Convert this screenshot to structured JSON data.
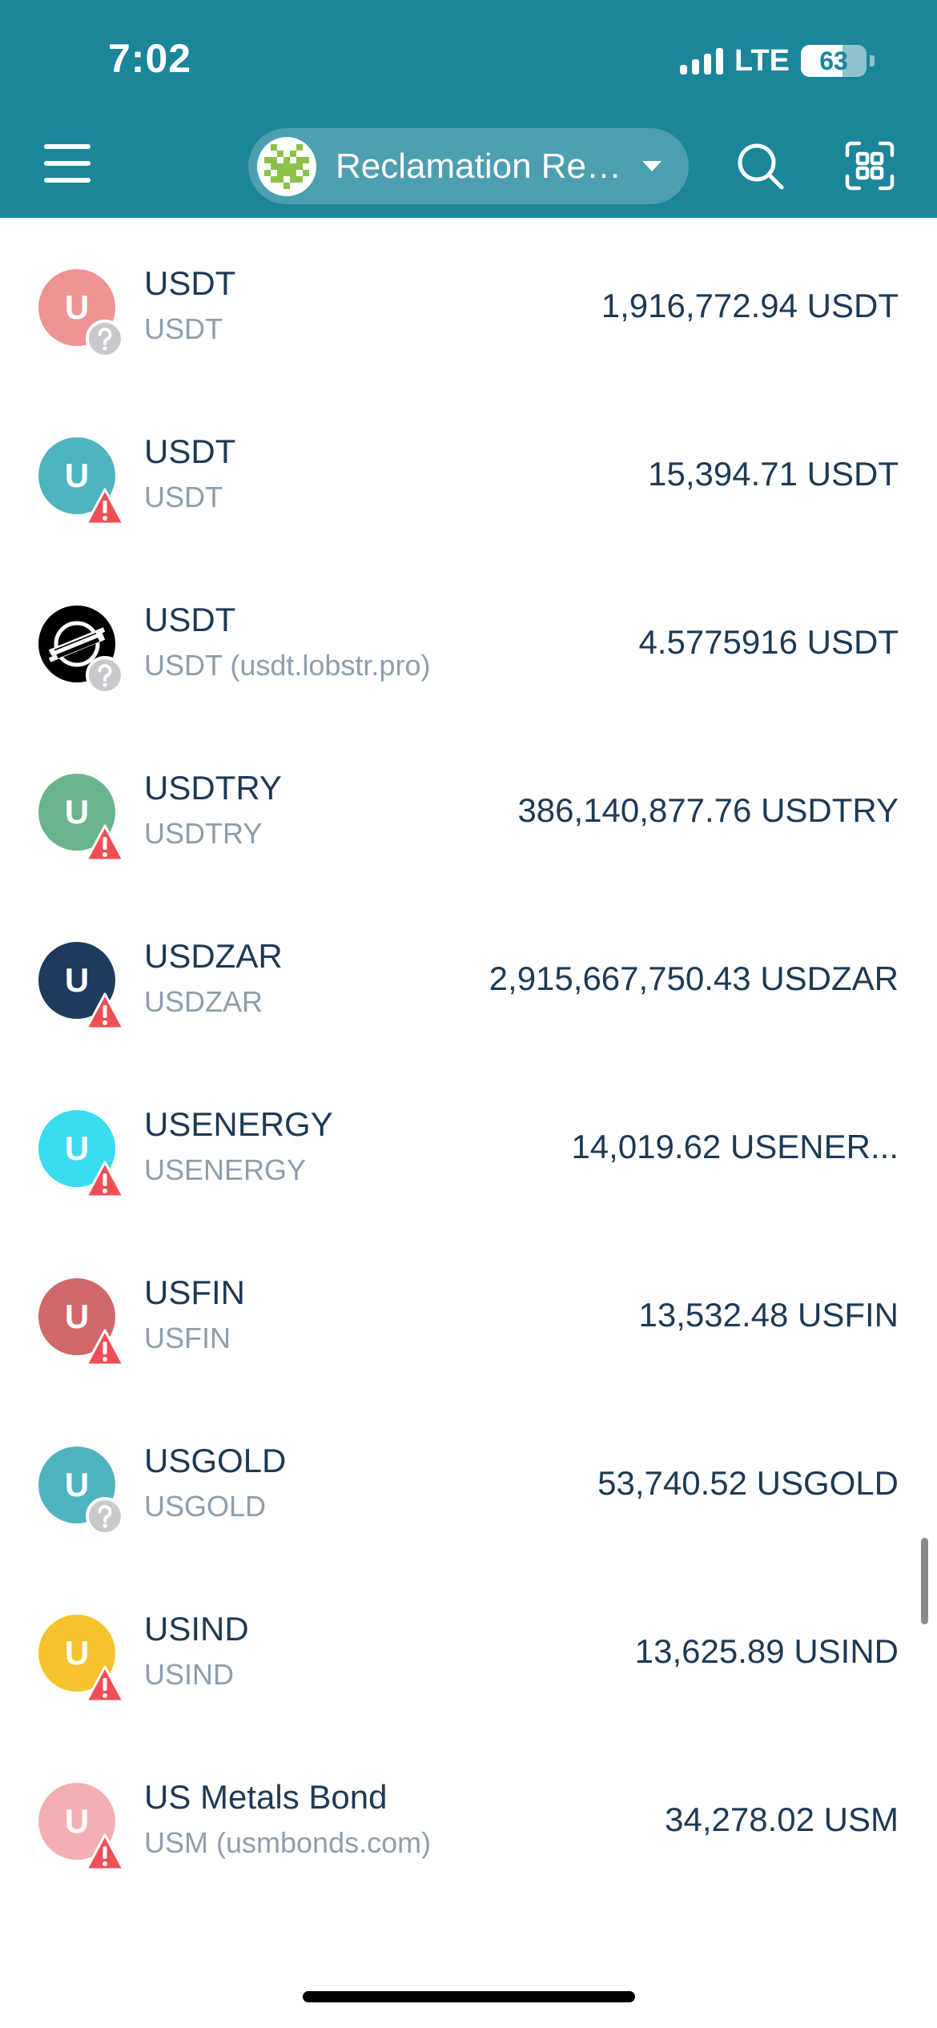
{
  "status_bar": {
    "time": "7:02",
    "network": "LTE",
    "battery": "63",
    "battery_level": 0.63
  },
  "header": {
    "account_name": "Reclamation Re…"
  },
  "tokens": [
    {
      "name": "USDT",
      "subtitle": "USDT",
      "balance": "1,916,772.94 USDT",
      "letter": "U",
      "color": "#ee9394",
      "badge": "unknown"
    },
    {
      "name": "USDT",
      "subtitle": "USDT",
      "balance": "15,394.71 USDT",
      "letter": "U",
      "color": "#4fb3c0",
      "badge": "warning"
    },
    {
      "name": "USDT",
      "subtitle": "USDT (usdt.lobstr.pro)",
      "balance": "4.5775916 USDT",
      "letter": "",
      "color": "#000000",
      "badge": "unknown",
      "logo": "stellar-logo"
    },
    {
      "name": "USDTRY",
      "subtitle": "USDTRY",
      "balance": "386,140,877.76 USDTRY",
      "letter": "U",
      "color": "#69b48c",
      "badge": "warning"
    },
    {
      "name": "USDZAR",
      "subtitle": "USDZAR",
      "balance": "2,915,667,750.43 USDZAR",
      "letter": "U",
      "color": "#1f3a5c",
      "badge": "warning"
    },
    {
      "name": "USENERGY",
      "subtitle": "USENERGY",
      "balance": "14,019.62 USENER...",
      "letter": "U",
      "color": "#39dbef",
      "badge": "warning"
    },
    {
      "name": "USFIN",
      "subtitle": "USFIN",
      "balance": "13,532.48 USFIN",
      "letter": "U",
      "color": "#d0676b",
      "badge": "warning"
    },
    {
      "name": "USGOLD",
      "subtitle": "USGOLD",
      "balance": "53,740.52 USGOLD",
      "letter": "U",
      "color": "#4fb3c0",
      "badge": "unknown"
    },
    {
      "name": "USIND",
      "subtitle": "USIND",
      "balance": "13,625.89 USIND",
      "letter": "U",
      "color": "#f7c32d",
      "badge": "warning"
    },
    {
      "name": "US Metals Bond",
      "subtitle": "USM (usmbonds.com)",
      "balance": "34,278.02 USM",
      "letter": "U",
      "color": "#f3b0b3",
      "badge": "warning"
    }
  ],
  "colors": {
    "header_bg": "#1b859a",
    "warning_red": "#ef4f55",
    "unknown_gray": "#c9c9cd"
  }
}
